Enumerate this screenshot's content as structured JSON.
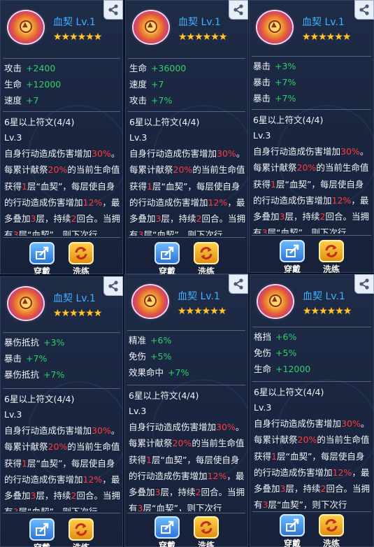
{
  "cards": [
    {
      "title": "血契 Lv.1",
      "stars": "★★★★★★",
      "stats": [
        {
          "k": "攻击",
          "v": "+2400"
        },
        {
          "k": "生命",
          "v": "+12000"
        },
        {
          "k": "速度",
          "v": "+7"
        }
      ]
    },
    {
      "title": "血契 Lv.1",
      "stars": "★★★★★★",
      "stats": [
        {
          "k": "生命",
          "v": "+36000"
        },
        {
          "k": "速度",
          "v": "+7"
        },
        {
          "k": "攻击",
          "v": "+7%"
        }
      ]
    },
    {
      "title": "血契 Lv.1",
      "stars": "★★★★★★",
      "stats": [
        {
          "k": "暴击",
          "v": "+3%"
        },
        {
          "k": "暴击",
          "v": "+7%"
        },
        {
          "k": "暴击",
          "v": "+7%"
        }
      ]
    },
    {
      "title": "血契 Lv.1",
      "stars": "★★★★★★",
      "stats": [
        {
          "k": "暴伤抵抗",
          "v": "+3%"
        },
        {
          "k": "暴击",
          "v": "+7%"
        },
        {
          "k": "暴伤抵抗",
          "v": "+7%"
        }
      ]
    },
    {
      "title": "血契 Lv.1",
      "stars": "★★★★★★",
      "stats": [
        {
          "k": "精准",
          "v": "+6%"
        },
        {
          "k": "免伤",
          "v": "+5%"
        },
        {
          "k": "效果命中",
          "v": "+7%"
        }
      ]
    },
    {
      "title": "血契 Lv.1",
      "stars": "★★★★★★",
      "stats": [
        {
          "k": "格挡",
          "v": "+6%"
        },
        {
          "k": "免伤",
          "v": "+5%"
        },
        {
          "k": "生命",
          "v": "+12000"
        }
      ]
    }
  ],
  "set_bonus": {
    "header": "6星以上符文(4/4)",
    "level": "Lv.3",
    "desc": {
      "p1": "自身行动造成伤害增加",
      "v1": "30%",
      "p2": "。每累计献祭",
      "v2": "20%",
      "p3": "的当前生命值获得",
      "v3": "1",
      "p4": "层“血契”，每层使自身的行动造成伤害增加",
      "v4": "12%",
      "p5": "，最多叠加",
      "v5": "3",
      "p6": "层，持续",
      "v6": "2",
      "p7": "回合。当拥有",
      "v7": "3",
      "p8": "层“血契”，则下次行"
    }
  },
  "buttons": {
    "equip": "穿戴",
    "reforge": "洗练"
  },
  "colors": {
    "title": "#3fb1ff",
    "stat_value": "#2fcf6a",
    "highlight": "#ff3b3b",
    "star": "#ffc52a"
  },
  "icons": [
    "share-icon",
    "equip-icon",
    "reforge-icon",
    "rune-gem-icon"
  ]
}
